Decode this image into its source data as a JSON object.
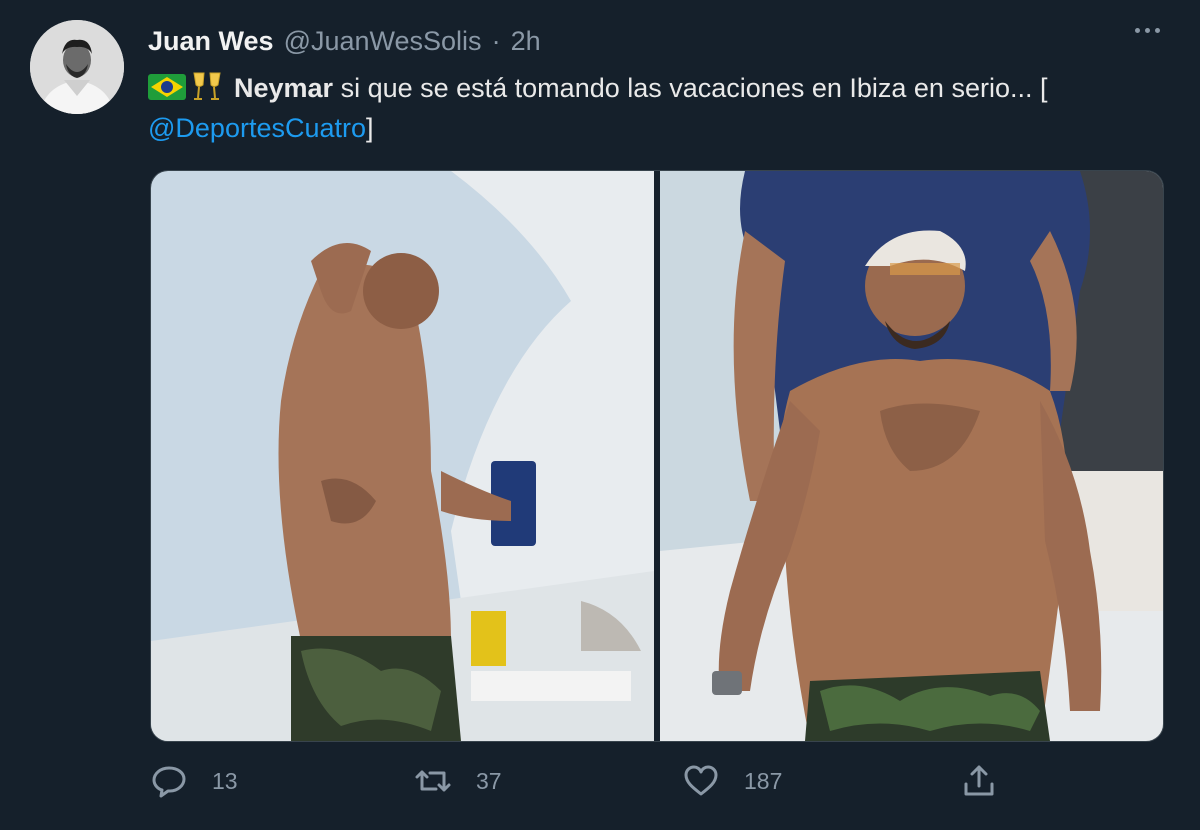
{
  "tweet": {
    "author_name": "Juan Wes",
    "handle": "@JuanWesSolis",
    "separator": "·",
    "time": "2h",
    "text_bold": "Neymar",
    "text_rest": " si que se está tomando las vacaciones en Ibiza en serio... [",
    "mention": "@DeportesCuatro",
    "text_end": "]"
  },
  "actions": {
    "reply_count": "13",
    "retweet_count": "37",
    "like_count": "187"
  },
  "colors": {
    "background": "#15202b",
    "link": "#1d9bf0",
    "muted": "#8a98a6"
  },
  "icons": [
    "brazil-flag-icon",
    "clinking-glasses-icon",
    "more-icon",
    "reply-icon",
    "retweet-icon",
    "like-icon",
    "share-icon"
  ]
}
